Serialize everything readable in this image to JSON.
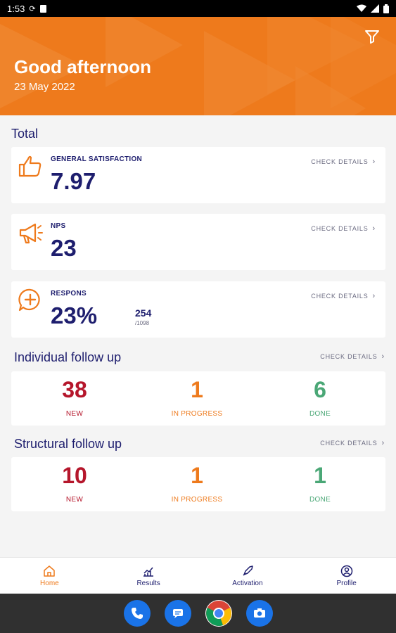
{
  "status_bar": {
    "time": "1:53"
  },
  "header": {
    "greeting": "Good afternoon",
    "date": "23 May 2022"
  },
  "total": {
    "title": "Total",
    "cards": [
      {
        "label": "GENERAL SATISFACTION",
        "value": "7.97",
        "check": "CHECK DETAILS"
      },
      {
        "label": "NPS",
        "value": "23",
        "check": "CHECK DETAILS"
      },
      {
        "label": "RESPONS",
        "value": "23%",
        "count": "254",
        "count_total": "/1098",
        "check": "CHECK DETAILS"
      }
    ]
  },
  "individual": {
    "title": "Individual follow up",
    "check": "CHECK DETAILS",
    "stats": [
      {
        "value": "38",
        "label": "NEW"
      },
      {
        "value": "1",
        "label": "IN PROGRESS"
      },
      {
        "value": "6",
        "label": "DONE"
      }
    ]
  },
  "structural": {
    "title": "Structural follow up",
    "check": "CHECK DETAILS",
    "stats": [
      {
        "value": "10",
        "label": "NEW"
      },
      {
        "value": "1",
        "label": "IN PROGRESS"
      },
      {
        "value": "1",
        "label": "DONE"
      }
    ]
  },
  "nav": {
    "items": [
      {
        "label": "Home",
        "icon": "home-icon"
      },
      {
        "label": "Results",
        "icon": "results-icon"
      },
      {
        "label": "Activation",
        "icon": "rocket-icon"
      },
      {
        "label": "Profile",
        "icon": "profile-icon"
      }
    ]
  },
  "colors": {
    "brand": "#ee7a1c",
    "navy": "#1e1e6e",
    "red": "#b5162b",
    "green": "#4aa776"
  }
}
